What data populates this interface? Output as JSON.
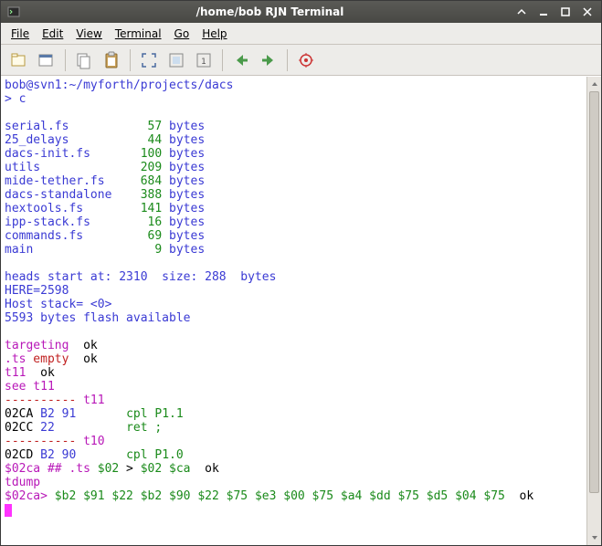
{
  "window": {
    "title": "/home/bob RJN Terminal"
  },
  "menu": {
    "file": "File",
    "edit": "Edit",
    "view": "View",
    "terminal": "Terminal",
    "go": "Go",
    "help": "Help"
  },
  "toolbar": {
    "new_tab": "new-tab",
    "new_window": "new-window",
    "copy": "copy",
    "paste": "paste",
    "fullscreen": "fullscreen",
    "zoom_fit": "zoom-fit",
    "zoom_1": "zoom-1",
    "prev": "prev",
    "next": "next",
    "record": "record"
  },
  "terminal": {
    "prompt_path": "bob@svn1:~/myforth/projects/dacs",
    "prompt_cmd": "> c",
    "files": [
      {
        "name": "serial.fs",
        "pad": "          ",
        "size": " 57",
        "unit": "bytes"
      },
      {
        "name": "25_delays",
        "pad": "          ",
        "size": " 44",
        "unit": "bytes"
      },
      {
        "name": "dacs-init.fs",
        "pad": "       ",
        "size": "100",
        "unit": "bytes"
      },
      {
        "name": "utils",
        "pad": "              ",
        "size": "209",
        "unit": "bytes"
      },
      {
        "name": "mide-tether.fs",
        "pad": "     ",
        "size": "684",
        "unit": "bytes"
      },
      {
        "name": "dacs-standalone",
        "pad": "    ",
        "size": "388",
        "unit": "bytes"
      },
      {
        "name": "hextools.fs",
        "pad": "        ",
        "size": "141",
        "unit": "bytes"
      },
      {
        "name": "ipp-stack.fs",
        "pad": "        ",
        "size": "16",
        "unit": "bytes"
      },
      {
        "name": "commands.fs",
        "pad": "         ",
        "size": "69",
        "unit": "bytes"
      },
      {
        "name": "main",
        "pad": "                ",
        "size": " 9",
        "unit": "bytes"
      }
    ],
    "heads_line": "heads start at: 2310  size: 288  bytes",
    "here_line": "HERE=2598",
    "host_stack": "Host stack= <0>",
    "flash": "5593 bytes flash available",
    "targeting": {
      "label": "targeting",
      "ok": "  ok"
    },
    "ts_empty": {
      "label": ".ts",
      "empty": " empty",
      "ok": "  ok"
    },
    "t11_ok": {
      "label": "t11",
      "ok": "  ok"
    },
    "see_t11": "see t11",
    "dash_t11": {
      "dash": "---------- ",
      "label": "t11"
    },
    "line_02CA": {
      "addr": "02CA ",
      "bytes": "B2 91       ",
      "instr": "cpl P1.1"
    },
    "line_02CC": {
      "addr": "02CC ",
      "bytes": "22          ",
      "instr": "ret ;"
    },
    "dash_t10": {
      "dash": "---------- ",
      "label": "t10"
    },
    "line_02CD": {
      "addr": "02CD ",
      "bytes": "B2 90       ",
      "instr": "cpl P1.0"
    },
    "stack_line": {
      "p1": "$02ca ## .ts ",
      "p2": "$02",
      "p3": " > ",
      "p4": "$02 $ca",
      "ok": "  ok"
    },
    "tdump": "tdump",
    "dump_line": {
      "addr": "$02ca>",
      "bytes": " $b2 $91 $22 $b2 $90 $22 $75 $e3 $00 $75 $a4 $dd $75 $d5 $04 $75",
      "ok": "  ok"
    }
  }
}
